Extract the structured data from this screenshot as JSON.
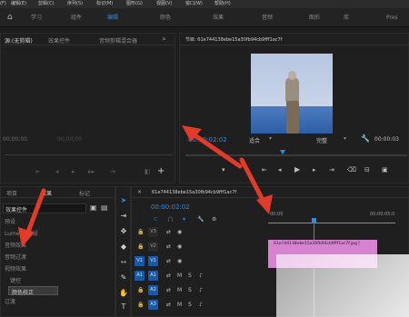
{
  "menu": [
    "(F)",
    "编辑(E)",
    "剪辑(C)",
    "序列(S)",
    "标记(M)",
    "图形(G)",
    "视图(V)",
    "窗口(W)",
    "帮助(H)"
  ],
  "workspaces": [
    {
      "label": "学习",
      "active": false
    },
    {
      "label": "组件",
      "active": false
    },
    {
      "label": "编辑",
      "active": true
    },
    {
      "label": "颜色",
      "active": false
    },
    {
      "label": "效果",
      "active": false
    },
    {
      "label": "音频",
      "active": false
    },
    {
      "label": "图形",
      "active": false
    },
    {
      "label": "库",
      "active": false
    },
    {
      "label": "Pres",
      "active": false
    }
  ],
  "source_panel": {
    "tabs": [
      "源:(无剪辑)",
      "效果控件",
      "音频剪辑混合器"
    ],
    "timecode": "00;00;00",
    "timecode_right": "00;00;00"
  },
  "program_panel": {
    "tab": "节目: 61e744138ebe15a30fb94cb9fff1ac7f",
    "timecode": "00:00:02:02",
    "fit_label": "适合",
    "quality_label": "完整",
    "duration": "00:00:03"
  },
  "project_panel": {
    "tabs": [
      "项目",
      "效果",
      "标记"
    ],
    "search_value": "效果控件",
    "items": [
      "预设",
      "Lumetri 预设",
      "音频效果",
      "音频过渡",
      "视频效果",
      "键控",
      "颜色校正",
      "过渡"
    ]
  },
  "timeline": {
    "tab": "61e744138ebe15a30fb94cb9fff1ac7f",
    "timecode": "00:00:02:02",
    "ruler_start": "00:00",
    "ruler_end": "00:00:05:0",
    "clip_label": "61e744138ebe15a30fb94cb9fff1ac7f.jpg [",
    "video_tracks": [
      "V3",
      "V2",
      "V1"
    ],
    "audio_tracks": [
      "A1",
      "A2",
      "A3"
    ]
  },
  "colors": {
    "accent": "#2d8ceb",
    "clip": "#d783d2",
    "arrow": "#e23b2a"
  }
}
